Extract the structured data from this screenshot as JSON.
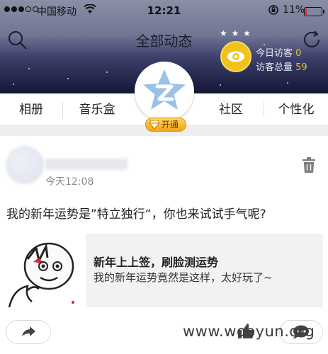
{
  "status_bar": {
    "carrier": "中国移动",
    "wifi_icon": "wifi-icon",
    "time": "12:21",
    "rotation_icon": "rotation-lock-icon",
    "battery": "11%",
    "battery_level": 0.11,
    "battery_color": "#dd2233"
  },
  "nav": {
    "title": "全部动态",
    "left_icon": "search-icon",
    "right_icon": "refresh-icon"
  },
  "visitors": {
    "today_label": "今日访客",
    "today_count": "0",
    "total_label": "访客总量",
    "total_count": "59",
    "accent": "#f5c21b"
  },
  "tabs": [
    {
      "label": "相册"
    },
    {
      "label": "音乐盒"
    },
    {
      "label": "社区"
    },
    {
      "label": "个性化"
    }
  ],
  "profile": {
    "badge": "开通"
  },
  "post": {
    "time": "今天12:08",
    "text": "我的新年运势是”特立独行“，你也来试试手气呢?",
    "card": {
      "title": "新年上上签，刷脸测运势",
      "desc": "我的新年运势竟然是这样，太好玩了~"
    },
    "actions": {
      "forward_icon": "forward-icon",
      "like_icon": "thumbs-up-icon",
      "comment_icon": "comment-icon"
    }
  },
  "watermark": "www.wooyun.org"
}
